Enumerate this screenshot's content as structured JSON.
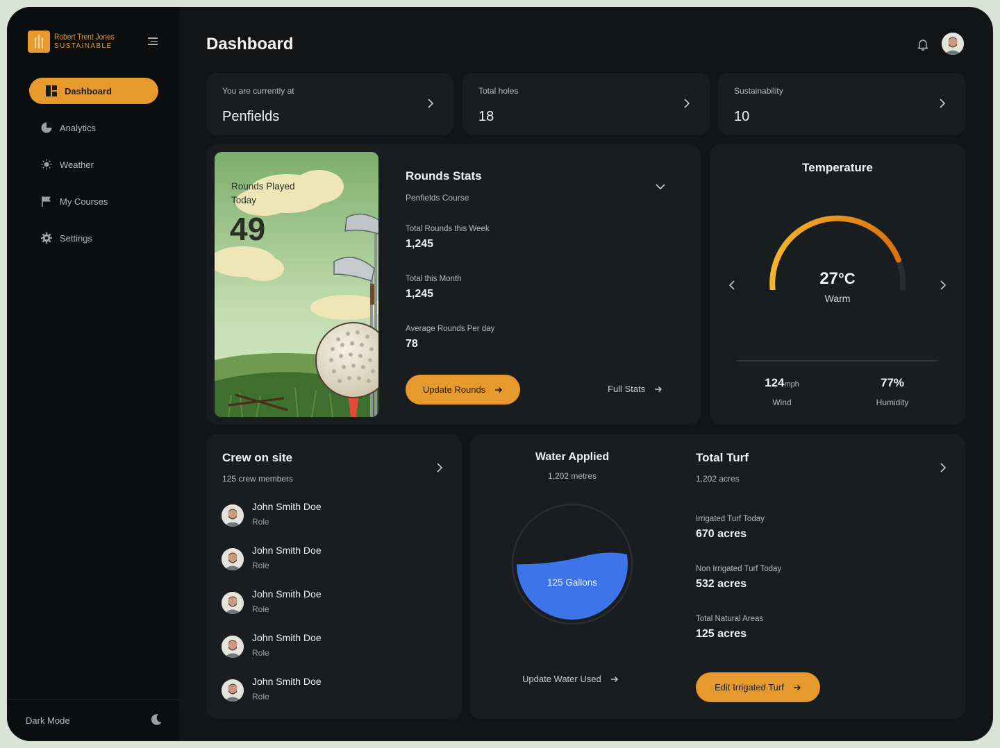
{
  "brand": {
    "name": "Robert Trent Jones",
    "sub": "SUSTAINABLE"
  },
  "colors": {
    "accent": "#e69a2e",
    "water": "#3d74ea",
    "background": "#121416",
    "card": "#1a1d20"
  },
  "sidebar": {
    "items": [
      {
        "label": "Dashboard",
        "icon": "dashboard-icon",
        "active": true
      },
      {
        "label": "Analytics",
        "icon": "pie-chart-icon"
      },
      {
        "label": "Weather",
        "icon": "sun-icon"
      },
      {
        "label": "My Courses",
        "icon": "flag-icon"
      },
      {
        "label": "Settings",
        "icon": "gear-icon"
      }
    ],
    "dark_mode_label": "Dark Mode"
  },
  "header": {
    "title": "Dashboard"
  },
  "stats": [
    {
      "label": "You are currently at",
      "value": "Penfields"
    },
    {
      "label": "Total holes",
      "value": "18"
    },
    {
      "label": "Sustainability",
      "value": "10"
    }
  ],
  "rounds": {
    "hero_label": "Rounds Played Today",
    "hero_value": "49",
    "title": "Rounds Stats",
    "subtitle": "Penfields Course",
    "items": [
      {
        "label": "Total Rounds this Week",
        "value": "1,245"
      },
      {
        "label": "Total this Month",
        "value": "1,245"
      },
      {
        "label": "Average Rounds Per day",
        "value": "78"
      }
    ],
    "update_button": "Update Rounds",
    "full_stats_link": "Full Stats"
  },
  "temperature": {
    "title": "Temperature",
    "value": "27",
    "unit": "°C",
    "status": "Warm",
    "gauge_fraction": 0.82,
    "wind_value": "124",
    "wind_unit": "mph",
    "wind_label": "Wind",
    "humidity_value": "77%",
    "humidity_label": "Humidity"
  },
  "crew": {
    "title": "Crew on site",
    "subtitle": "125 crew members",
    "members": [
      {
        "name": "John Smith Doe",
        "role": "Role"
      },
      {
        "name": "John Smith Doe",
        "role": "Role"
      },
      {
        "name": "John Smith Doe",
        "role": "Role"
      },
      {
        "name": "John Smith Doe",
        "role": "Role"
      },
      {
        "name": "John Smith Doe",
        "role": "Role"
      }
    ]
  },
  "water": {
    "title": "Water Applied",
    "subtitle": "1,202 metres",
    "fill_label": "125 Gallons",
    "fill_fraction": 0.55,
    "update_link": "Update Water Used"
  },
  "turf": {
    "title": "Total Turf",
    "subtitle": "1,202 acres",
    "items": [
      {
        "label": "Irrigated Turf Today",
        "value": "670 acres"
      },
      {
        "label": "Non Irrigated Turf Today",
        "value": "532 acres"
      },
      {
        "label": "Total Natural Areas",
        "value": "125 acres"
      }
    ],
    "edit_button": "Edit Irrigated Turf"
  }
}
